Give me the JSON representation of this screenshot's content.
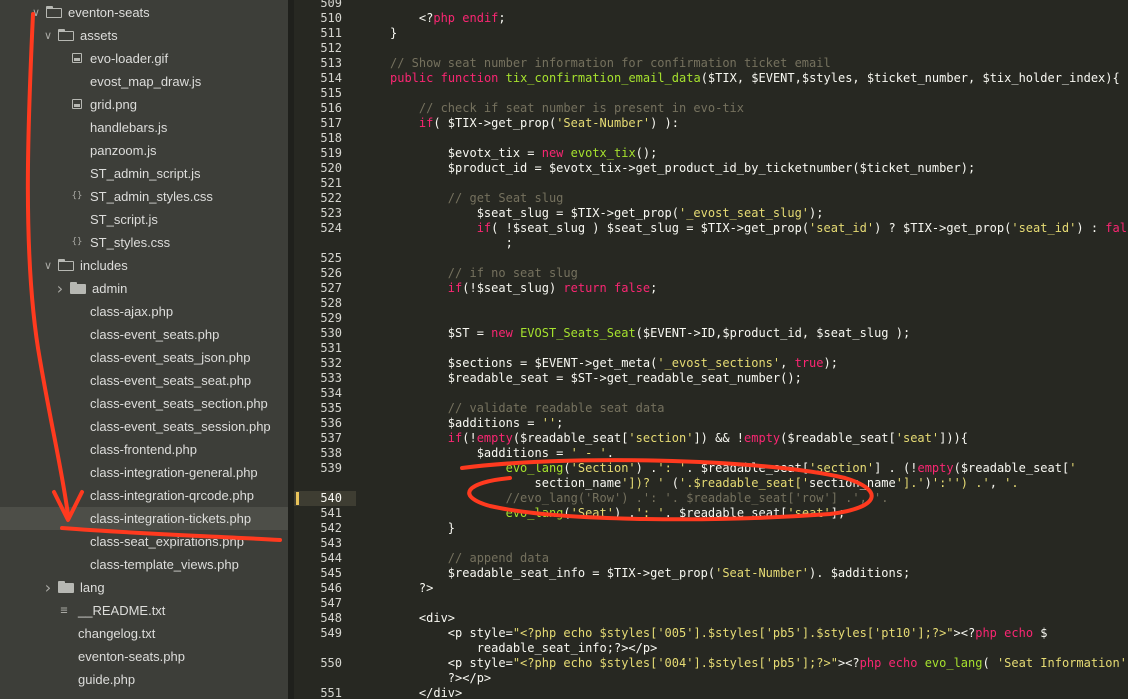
{
  "sidebar": {
    "items": [
      {
        "label": "eventon-seats",
        "type": "folder-open"
      },
      {
        "label": "assets",
        "type": "folder-open"
      },
      {
        "label": "evo-loader.gif",
        "type": "image"
      },
      {
        "label": "evost_map_draw.js",
        "type": "file"
      },
      {
        "label": "grid.png",
        "type": "image"
      },
      {
        "label": "handlebars.js",
        "type": "file"
      },
      {
        "label": "panzoom.js",
        "type": "file"
      },
      {
        "label": "ST_admin_script.js",
        "type": "file"
      },
      {
        "label": "ST_admin_styles.css",
        "type": "css"
      },
      {
        "label": "ST_script.js",
        "type": "file"
      },
      {
        "label": "ST_styles.css",
        "type": "css"
      },
      {
        "label": "includes",
        "type": "folder-open"
      },
      {
        "label": "admin",
        "type": "folder-closed"
      },
      {
        "label": "class-ajax.php",
        "type": "file"
      },
      {
        "label": "class-event_seats.php",
        "type": "file"
      },
      {
        "label": "class-event_seats_json.php",
        "type": "file"
      },
      {
        "label": "class-event_seats_seat.php",
        "type": "file"
      },
      {
        "label": "class-event_seats_section.php",
        "type": "file"
      },
      {
        "label": "class-event_seats_session.php",
        "type": "file"
      },
      {
        "label": "class-frontend.php",
        "type": "file"
      },
      {
        "label": "class-integration-general.php",
        "type": "file"
      },
      {
        "label": "class-integration-qrcode.php",
        "type": "file"
      },
      {
        "label": "class-integration-tickets.php",
        "type": "file",
        "selected": true
      },
      {
        "label": "class-seat_expirations.php",
        "type": "file"
      },
      {
        "label": "class-template_views.php",
        "type": "file"
      },
      {
        "label": "lang",
        "type": "folder-closed"
      },
      {
        "label": "__README.txt",
        "type": "readme"
      },
      {
        "label": "changelog.txt",
        "type": "file"
      },
      {
        "label": "eventon-seats.php",
        "type": "file"
      },
      {
        "label": "guide.php",
        "type": "file"
      }
    ]
  },
  "editor": {
    "current_line": "540",
    "lines": [
      {
        "n": "509",
        "text": ""
      },
      {
        "n": "510",
        "text": "    <?php endif;"
      },
      {
        "n": "511",
        "text": "}"
      },
      {
        "n": "512",
        "text": ""
      },
      {
        "n": "513",
        "text": "// Show seat number information for confirmation ticket email"
      },
      {
        "n": "514",
        "text": "public function tix_confirmation_email_data($TIX, $EVENT,$styles, $ticket_number, $tix_holder_index){"
      },
      {
        "n": "515",
        "text": ""
      },
      {
        "n": "516",
        "text": "    // check if seat number is present in evo-tix"
      },
      {
        "n": "517",
        "text": "    if( $TIX->get_prop('Seat-Number') ):"
      },
      {
        "n": "518",
        "text": ""
      },
      {
        "n": "519",
        "text": "        $evotx_tix = new evotx_tix();"
      },
      {
        "n": "520",
        "text": "        $product_id = $evotx_tix->get_product_id_by_ticketnumber($ticket_number);"
      },
      {
        "n": "521",
        "text": ""
      },
      {
        "n": "522",
        "text": "        // get Seat slug"
      },
      {
        "n": "523",
        "text": "            $seat_slug = $TIX->get_prop('_evost_seat_slug');"
      },
      {
        "n": "524",
        "text": "            if( !$seat_slug ) $seat_slug = $TIX->get_prop('seat_id') ? $TIX->get_prop('seat_id') : false"
      },
      {
        "n": "",
        "text": "                ;"
      },
      {
        "n": "525",
        "text": ""
      },
      {
        "n": "526",
        "text": "        // if no seat slug"
      },
      {
        "n": "527",
        "text": "        if(!$seat_slug) return false;"
      },
      {
        "n": "528",
        "text": ""
      },
      {
        "n": "529",
        "text": ""
      },
      {
        "n": "530",
        "text": "        $ST = new EVOST_Seats_Seat($EVENT->ID,$product_id, $seat_slug );"
      },
      {
        "n": "531",
        "text": ""
      },
      {
        "n": "532",
        "text": "        $sections = $EVENT->get_meta('_evost_sections', true);"
      },
      {
        "n": "533",
        "text": "        $readable_seat = $ST->get_readable_seat_number();"
      },
      {
        "n": "534",
        "text": ""
      },
      {
        "n": "535",
        "text": "        // validate readable seat data"
      },
      {
        "n": "536",
        "text": "        $additions = '';"
      },
      {
        "n": "537",
        "text": "        if(!empty($readable_seat['section']) && !empty($readable_seat['seat'])){"
      },
      {
        "n": "538",
        "text": "            $additions = ' - '."
      },
      {
        "n": "539",
        "text": "                evo_lang('Section') .': '. $readable_seat['section'] . (!empty($readable_seat['"
      },
      {
        "n": "",
        "text": "                    section_name'])? ' ('.$readable_seat['section_name'].')':'') .', '."
      },
      {
        "n": "540",
        "text": "                //evo_lang('Row') .': '. $readable_seat['row'] .', '."
      },
      {
        "n": "541",
        "text": "                evo_lang('Seat') .': '. $readable_seat['seat'];"
      },
      {
        "n": "542",
        "text": "        }"
      },
      {
        "n": "543",
        "text": ""
      },
      {
        "n": "544",
        "text": "        // append data"
      },
      {
        "n": "545",
        "text": "        $readable_seat_info = $TIX->get_prop('Seat-Number'). $additions;"
      },
      {
        "n": "546",
        "text": "    ?>"
      },
      {
        "n": "547",
        "text": ""
      },
      {
        "n": "548",
        "text": "    <div>"
      },
      {
        "n": "549",
        "text": "        <p style=\"<?php echo $styles['005'].$styles['pb5'].$styles['pt10'];?>\"><?php echo $"
      },
      {
        "n": "",
        "text": "            readable_seat_info;?></p>"
      },
      {
        "n": "550",
        "text": "        <p style=\"<?php echo $styles['004'].$styles['pb5'];?>\"><?php echo evo_lang( 'Seat Information');"
      },
      {
        "n": "",
        "text": "        ?></p>"
      },
      {
        "n": "551",
        "text": "    </div>"
      }
    ]
  },
  "colors": {
    "keyword": "#f92672",
    "string": "#e6db74",
    "comment": "#75715e",
    "function": "#a6e22e",
    "annotation": "#ff3a1f"
  }
}
